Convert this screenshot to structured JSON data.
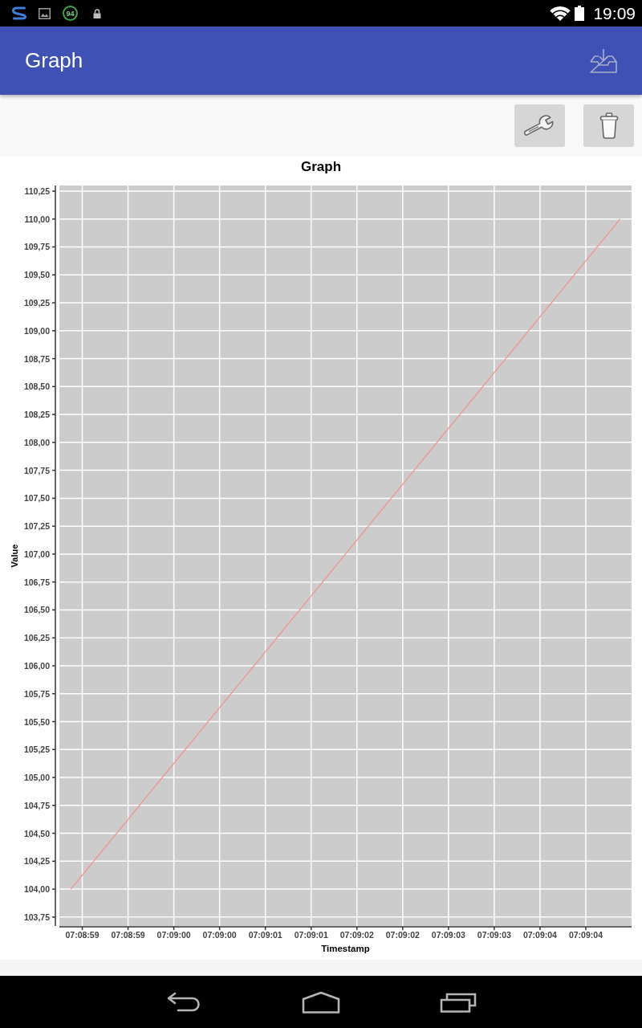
{
  "status_bar": {
    "badge": "94",
    "time": "19:09"
  },
  "app_bar": {
    "title": "Graph"
  },
  "chart": {
    "chart_data": {
      "type": "line",
      "title": "Graph",
      "xlabel": "Timestamp",
      "ylabel": "Value",
      "grid": true,
      "categories": [
        null,
        "07:08:59",
        null,
        null,
        null,
        "07:08:59",
        null,
        null,
        null,
        "07:09:00",
        null,
        null,
        null,
        "07:09:00",
        null,
        null,
        null,
        "07:09:01",
        null,
        null,
        null,
        "07:09:01",
        null,
        null,
        null,
        "07:09:02",
        null,
        null,
        null,
        "07:09:02",
        null,
        null,
        null,
        "07:09:03",
        null,
        null,
        null,
        "07:09:03",
        null,
        null,
        null,
        "07:09:04",
        null,
        null,
        null,
        "07:09:04",
        null,
        null,
        null
      ],
      "values": [
        104,
        104.125,
        104.25,
        104.375,
        104.5,
        104.625,
        104.75,
        104.875,
        105,
        105.125,
        105.25,
        105.375,
        105.5,
        105.625,
        105.75,
        105.875,
        106,
        106.125,
        106.25,
        106.375,
        106.5,
        106.625,
        106.75,
        106.875,
        107,
        107.125,
        107.25,
        107.375,
        107.5,
        107.625,
        107.75,
        107.875,
        108,
        108.125,
        108.25,
        108.375,
        108.5,
        108.625,
        108.75,
        108.875,
        109,
        109.125,
        109.25,
        109.375,
        109.5,
        109.625,
        109.75,
        109.875,
        110
      ],
      "ylim": [
        103.67,
        110.3
      ],
      "yticks": [
        {
          "value": 103.75,
          "label": "103,75"
        },
        {
          "value": 104,
          "label": "104,00"
        },
        {
          "value": 104.25,
          "label": "104,25"
        },
        {
          "value": 104.5,
          "label": "104,50"
        },
        {
          "value": 104.75,
          "label": "104,75"
        },
        {
          "value": 105,
          "label": "105,00"
        },
        {
          "value": 105.25,
          "label": "105,25"
        },
        {
          "value": 105.5,
          "label": "105,50"
        },
        {
          "value": 105.75,
          "label": "105,75"
        },
        {
          "value": 106,
          "label": "106,00"
        },
        {
          "value": 106.25,
          "label": "106,25"
        },
        {
          "value": 106.5,
          "label": "106,50"
        },
        {
          "value": 106.75,
          "label": "106,75"
        },
        {
          "value": 107,
          "label": "107,00"
        },
        {
          "value": 107.25,
          "label": "107,25"
        },
        {
          "value": 107.5,
          "label": "107,50"
        },
        {
          "value": 107.75,
          "label": "107,75"
        },
        {
          "value": 108,
          "label": "108,00"
        },
        {
          "value": 108.25,
          "label": "108,25"
        },
        {
          "value": 108.5,
          "label": "108,50"
        },
        {
          "value": 108.75,
          "label": "108,75"
        },
        {
          "value": 109,
          "label": "109,00"
        },
        {
          "value": 109.25,
          "label": "109,25"
        },
        {
          "value": 109.5,
          "label": "109,50"
        },
        {
          "value": 109.75,
          "label": "109,75"
        },
        {
          "value": 110,
          "label": "110,00"
        },
        {
          "value": 110.25,
          "label": "110,25"
        }
      ]
    }
  }
}
